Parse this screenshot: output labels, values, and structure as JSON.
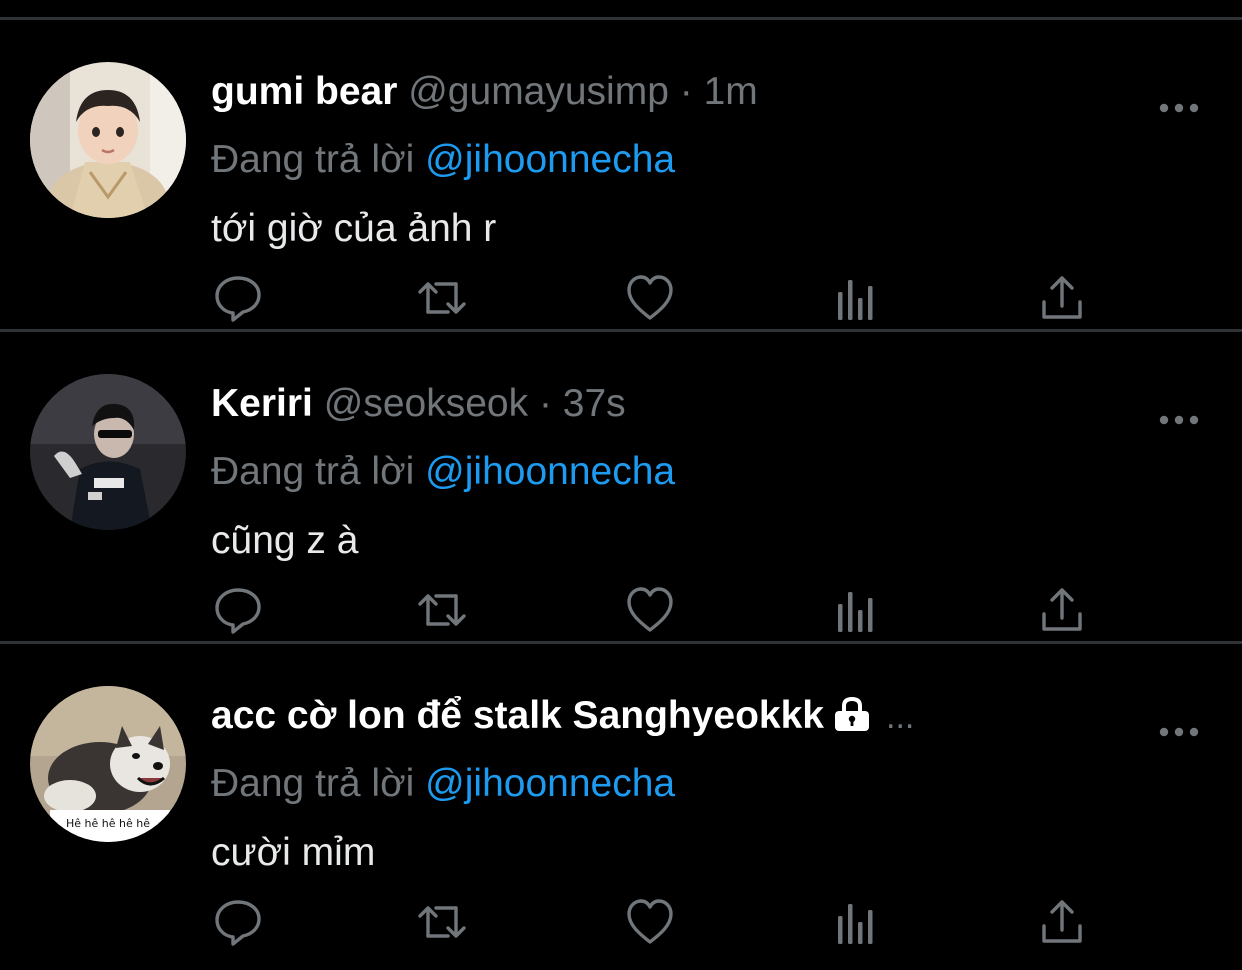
{
  "timeline": {
    "tweets": [
      {
        "name": "gumi bear",
        "handle": "@gumayusimp",
        "separator": "·",
        "time": "1m",
        "reply_prefix": "Đang trả lời",
        "reply_to": "@jihoonnecha",
        "text": "tới giờ của ảnh r",
        "avatar_icon": "child-photo-avatar"
      },
      {
        "name": "Keriri",
        "handle": "@seokseok",
        "separator": "·",
        "time": "37s",
        "reply_prefix": "Đang trả lời",
        "reply_to": "@jihoonnecha",
        "text": "cũng z à",
        "avatar_icon": "player-photo-avatar"
      },
      {
        "name": "acc cờ lon để stalk Sanghyeokkk",
        "name_truncation": "...",
        "protected_icon": "lock-icon",
        "reply_prefix": "Đang trả lời",
        "reply_to": "@jihoonnecha",
        "text": "cười mỉm",
        "avatar_icon": "husky-meme-avatar",
        "avatar_caption": "Hê hê hê hê hê"
      }
    ]
  },
  "actions": [
    "reply-icon",
    "retweet-icon",
    "like-icon",
    "views-icon",
    "share-icon"
  ],
  "colors": {
    "background": "#000000",
    "divider": "#2f3336",
    "primary_text": "#e7e9ea",
    "secondary_text": "#71767b",
    "accent": "#1d9bf0"
  }
}
